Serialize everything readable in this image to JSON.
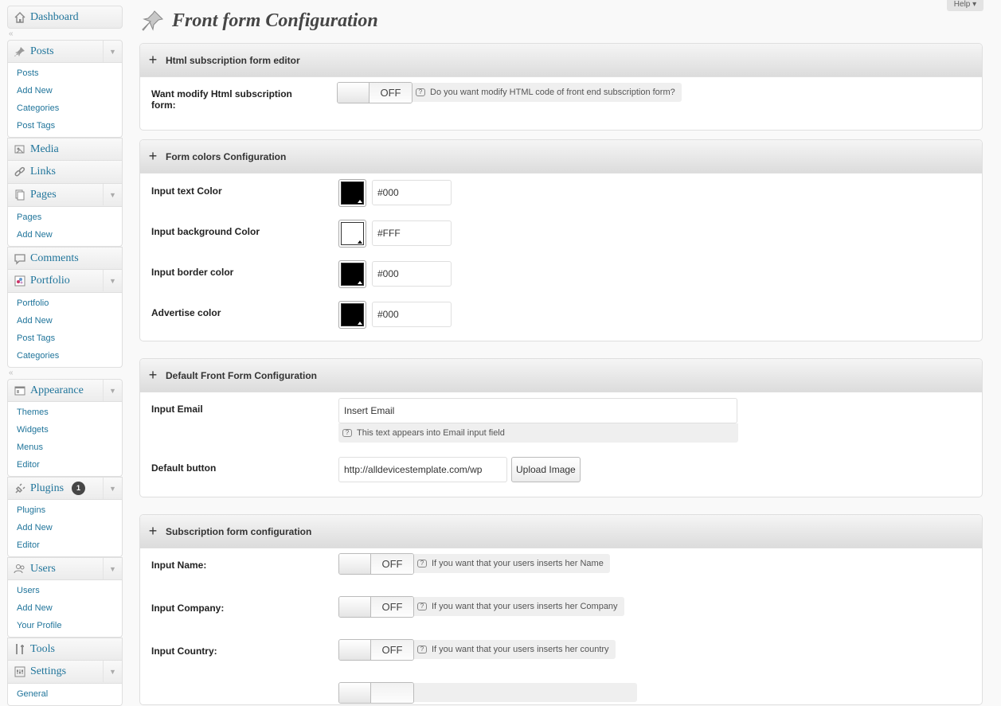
{
  "sidebar": {
    "dashboard": "Dashboard",
    "posts": {
      "label": "Posts",
      "items": [
        "Posts",
        "Add New",
        "Categories",
        "Post Tags"
      ]
    },
    "media": "Media",
    "links": "Links",
    "pages": {
      "label": "Pages",
      "items": [
        "Pages",
        "Add New"
      ]
    },
    "comments": "Comments",
    "portfolio": {
      "label": "Portfolio",
      "items": [
        "Portfolio",
        "Add New",
        "Post Tags",
        "Categories"
      ]
    },
    "appearance": {
      "label": "Appearance",
      "items": [
        "Themes",
        "Widgets",
        "Menus",
        "Editor"
      ]
    },
    "plugins": {
      "label": "Plugins",
      "badge": "1",
      "items": [
        "Plugins",
        "Add New",
        "Editor"
      ]
    },
    "users": {
      "label": "Users",
      "items": [
        "Users",
        "Add New",
        "Your Profile"
      ]
    },
    "tools": "Tools",
    "settings": {
      "label": "Settings",
      "items": [
        "General"
      ]
    }
  },
  "header": {
    "title": "Front form Configuration",
    "help": "Help"
  },
  "panels": {
    "html_editor": {
      "title": "Html subscription form editor",
      "label": "Want modify Html subscription form:",
      "toggle": "OFF",
      "tip": "Do you want modify HTML code of front end subscription form?"
    },
    "colors": {
      "title": "Form colors Configuration",
      "rows": [
        {
          "label": "Input text Color",
          "value": "#000",
          "swatch": "#000000"
        },
        {
          "label": "Input background Color",
          "value": "#FFF",
          "swatch": "#FFFFFF"
        },
        {
          "label": "Input border color",
          "value": "#000",
          "swatch": "#000000"
        },
        {
          "label": "Advertise color",
          "value": "#000",
          "swatch": "#000000"
        }
      ]
    },
    "default_form": {
      "title": "Default Front Form Configuration",
      "email_label": "Input Email",
      "email_value": "Insert Email",
      "email_tip": "This text appears into Email input field",
      "button_label": "Default button",
      "button_url": "http://alldevicestemplate.com/wp",
      "upload_label": "Upload Image"
    },
    "subscription": {
      "title": "Subscription form configuration",
      "rows": [
        {
          "label": "Input Name:",
          "toggle": "OFF",
          "tip": "If you want that your users inserts her Name"
        },
        {
          "label": "Input Company:",
          "toggle": "OFF",
          "tip": "If you want that your users inserts her Company"
        },
        {
          "label": "Input Country:",
          "toggle": "OFF",
          "tip": "If you want that your users inserts her country"
        }
      ]
    }
  }
}
